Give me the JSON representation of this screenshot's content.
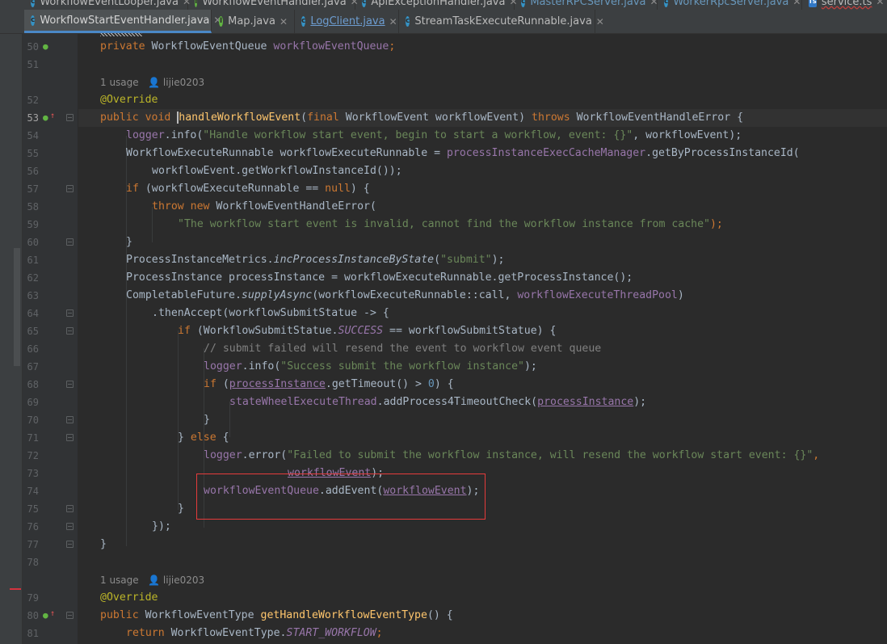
{
  "top_tabs": [
    {
      "label": "WorkflowEventLooper.java",
      "icon": "class-icon"
    },
    {
      "label": "WorkflowEventHandler.java",
      "icon": "interface-icon"
    },
    {
      "label": "ApiExceptionHandler.java",
      "icon": "class-icon"
    },
    {
      "label": "MasterRPCServer.java",
      "icon": "class-icon"
    },
    {
      "label": "WorkerRpcServer.java",
      "icon": "class-icon"
    },
    {
      "label": "service.ts",
      "icon": "ts-icon"
    }
  ],
  "tabs": [
    {
      "label": "WorkflowStartEventHandler.java",
      "icon": "class-icon",
      "active": true
    },
    {
      "label": "Map.java",
      "icon": "interface-icon"
    },
    {
      "label": "LogClient.java",
      "icon": "class-icon"
    },
    {
      "label": "StreamTaskExecuteRunnable.java",
      "icon": "class-icon"
    }
  ],
  "usage_hint_1": {
    "usages": "1 usage",
    "author": "lijie0203"
  },
  "usage_hint_2": {
    "usages": "1 usage",
    "author": "lijie0203"
  },
  "line_numbers": [
    "50",
    "51",
    "52",
    "53",
    "54",
    "55",
    "56",
    "57",
    "58",
    "59",
    "60",
    "61",
    "62",
    "63",
    "64",
    "65",
    "66",
    "67",
    "68",
    "69",
    "70",
    "71",
    "72",
    "73",
    "74",
    "75",
    "76",
    "77",
    "78",
    "79",
    "80",
    "81"
  ],
  "current_line": "53",
  "code": {
    "l50": {
      "kw": "private ",
      "type": "WorkflowEventQueue ",
      "field": "workflowEventQueue",
      "end": ";"
    },
    "l52": "@Override",
    "l53": {
      "kw1": "public void ",
      "caret_char": "h",
      "fn": "andleWorkflowEvent",
      "p1": "(",
      "kw2": "final ",
      "params": "WorkflowEvent workflowEvent) ",
      "kw3": "throws ",
      "rest": "WorkflowEventHandleError {"
    },
    "l54": {
      "field": "logger",
      "a": ".info(",
      "str": "\"Handle workflow start event, begin to start a workflow, event: {}\"",
      "b": ", workflowEvent);"
    },
    "l55": {
      "a": "WorkflowExecuteRunnable workflowExecuteRunnable = ",
      "field": "processInstanceExecCacheManager",
      "b": ".getByProcessInstanceId("
    },
    "l56": "workflowEvent.getWorkflowInstanceId());",
    "l57": {
      "kw": "if ",
      "a": "(workflowExecuteRunnable == ",
      "kw2": "null",
      "b": ") {"
    },
    "l58": {
      "kw": "throw new ",
      "a": "WorkflowEventHandleError("
    },
    "l59": {
      "str": "\"The workflow start event is invalid, cannot find the workflow instance from cache\"",
      "b": ");"
    },
    "l60": "}",
    "l61": {
      "a": "ProcessInstanceMetrics.",
      "sm": "incProcessInstanceByState",
      "p": "(",
      "str": "\"submit\"",
      "b": ");"
    },
    "l62": "ProcessInstance processInstance = workflowExecuteRunnable.getProcessInstance();",
    "l63": {
      "a": "CompletableFuture.",
      "sm": "supplyAsync",
      "b": "(workflowExecuteRunnable::call, ",
      "field": "workflowExecuteThreadPool",
      "c": ")"
    },
    "l64": ".thenAccept(workflowSubmitStatue -> {",
    "l65": {
      "kw": "if ",
      "a": "(WorkflowSubmitStatue.",
      "sf": "SUCCESS",
      "b": " == workflowSubmitStatue) {"
    },
    "l66": "// submit failed will resend the event to workflow event queue",
    "l67": {
      "field": "logger",
      "a": ".info(",
      "str": "\"Success submit the workflow instance\"",
      "b": ");"
    },
    "l68": {
      "kw": "if ",
      "p": "(",
      "field": "processInstance",
      "a": ".getTimeout() > ",
      "num": "0",
      "b": ") {"
    },
    "l69": {
      "field": "stateWheelExecuteThread",
      "a": ".addProcess4TimeoutCheck(",
      "field2": "processInstance",
      "b": ");"
    },
    "l70": "}",
    "l71": {
      "a": "} ",
      "kw": "else",
      "b": " {"
    },
    "l72": {
      "field": "logger",
      "a": ".error(",
      "str": "\"Failed to submit the workflow instance, will resend the workflow start event: {}\"",
      "b": ","
    },
    "l73": {
      "field": "workflowEvent",
      "b": ");"
    },
    "l74": {
      "field": "workflowEventQueue",
      "a": ".addEvent(",
      "field2": "workflowEvent",
      "b": ");"
    },
    "l75": "}",
    "l76": "});",
    "l77": "}",
    "l79": "@Override",
    "l80": {
      "kw": "public ",
      "a": "WorkflowEventType ",
      "fn": "getHandleWorkflowEventType",
      "b": "() {"
    },
    "l81": {
      "kw": "return ",
      "a": "WorkflowEventType.",
      "sf": "START_WORKFLOW",
      "b": ";"
    }
  }
}
